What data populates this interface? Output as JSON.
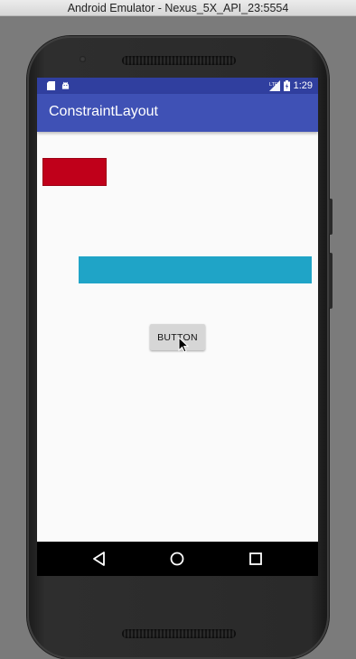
{
  "window": {
    "title": "Android Emulator - Nexus_5X_API_23:5554"
  },
  "status_bar": {
    "left_icons": [
      "sd-card-icon",
      "android-icon"
    ],
    "network": "LTE",
    "time": "1:29",
    "color": "#303f9f"
  },
  "app_bar": {
    "title": "ConstraintLayout",
    "color": "#3f51b5"
  },
  "content": {
    "red_box_color": "#c0001a",
    "cyan_box_color": "#1fa4c7",
    "button_label": "BUTTON"
  },
  "nav_bar": {
    "items": [
      "back-icon",
      "home-icon",
      "recents-icon"
    ]
  }
}
